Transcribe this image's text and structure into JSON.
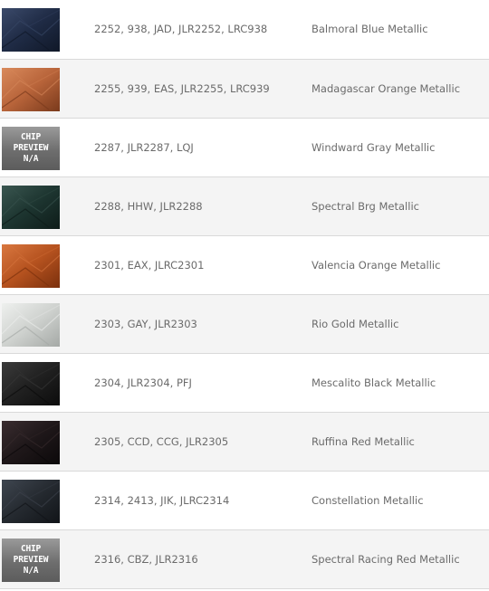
{
  "rows": [
    {
      "codes": "2252, 938, JAD, JLR2252, LRC938",
      "name": "Balmoral Blue Metallic",
      "chip": {
        "base": "#1f2b45",
        "dark": "#101828",
        "light": "#3b4a6a"
      }
    },
    {
      "codes": "2255, 939, EAS, JLR2255, LRC939",
      "name": "Madagascar Orange Metallic",
      "chip": {
        "base": "#b8643a",
        "dark": "#7a3a1c",
        "light": "#d98a5c"
      }
    },
    {
      "codes": "2287, JLR2287, LQJ",
      "name": "Windward Gray Metallic",
      "chip": null
    },
    {
      "codes": "2288, HHW, JLR2288",
      "name": "Spectral Brg Metallic",
      "chip": {
        "base": "#1d3530",
        "dark": "#0e1c19",
        "light": "#3a5650"
      }
    },
    {
      "codes": "2301, EAX, JLRC2301",
      "name": "Valencia Orange Metallic",
      "chip": {
        "base": "#b5521f",
        "dark": "#7b300d",
        "light": "#d9773f"
      }
    },
    {
      "codes": "2303, GAY, JLR2303",
      "name": "Rio Gold Metallic",
      "chip": {
        "base": "#cfd2cf",
        "dark": "#a5a9a6",
        "light": "#eef0ee"
      }
    },
    {
      "codes": "2304, JLR2304, PFJ",
      "name": "Mescalito Black Metallic",
      "chip": {
        "base": "#202020",
        "dark": "#0c0c0c",
        "light": "#3b3b3b"
      }
    },
    {
      "codes": "2305, CCD, CCG, JLR2305",
      "name": "Ruffina Red Metallic",
      "chip": {
        "base": "#1e1719",
        "dark": "#0c090a",
        "light": "#3a2d30"
      }
    },
    {
      "codes": "2314, 2413, JIK, JLRC2314",
      "name": "Constellation Metallic",
      "chip": {
        "base": "#252a30",
        "dark": "#111418",
        "light": "#3f4650"
      }
    },
    {
      "codes": "2316, CBZ, JLR2316",
      "name": "Spectral Racing Red Metallic",
      "chip": null
    }
  ],
  "chip_na": {
    "line1": "CHIP",
    "line2": "PREVIEW",
    "line3": "N/A"
  }
}
